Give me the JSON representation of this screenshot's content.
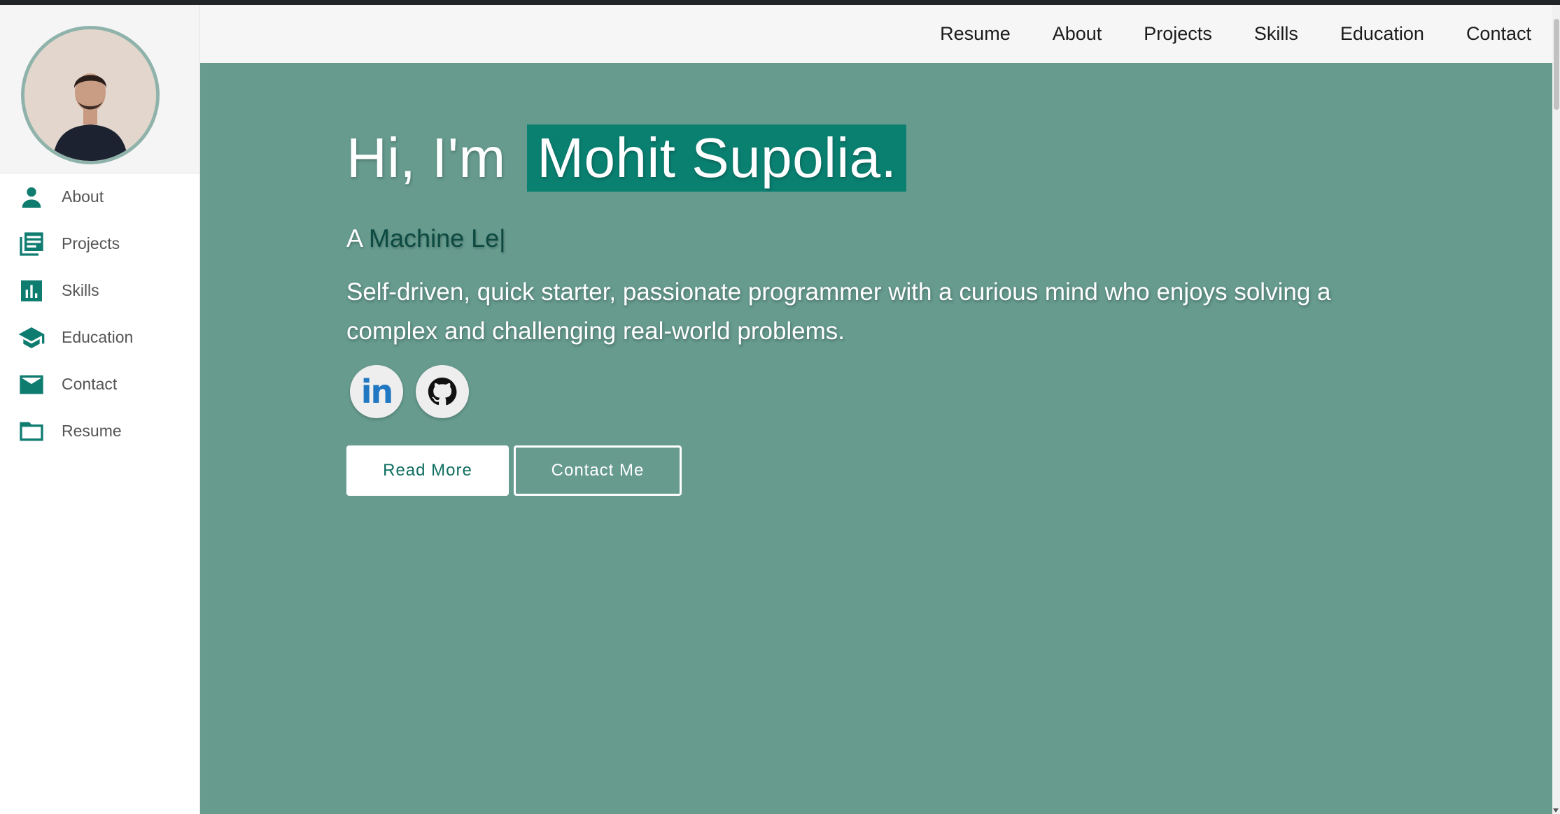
{
  "sidebar": {
    "items": [
      {
        "label": "About",
        "icon": "person-icon"
      },
      {
        "label": "Projects",
        "icon": "list-icon"
      },
      {
        "label": "Skills",
        "icon": "bar-chart-icon"
      },
      {
        "label": "Education",
        "icon": "graduation-cap-icon"
      },
      {
        "label": "Contact",
        "icon": "mail-icon"
      },
      {
        "label": "Resume",
        "icon": "folder-icon"
      }
    ]
  },
  "topnav": {
    "links": [
      "Resume",
      "About",
      "Projects",
      "Skills",
      "Education",
      "Contact"
    ]
  },
  "hero": {
    "greeting": "Hi, I'm",
    "name": "Mohit Supolia.",
    "typed_prefix": "A",
    "typed_text": "Machine Le",
    "typed_cursor": "|",
    "tagline": "Self-driven, quick starter, passionate programmer with a curious mind who enjoys solving a complex and challenging real-world problems.",
    "socials": [
      {
        "icon": "linkedin-icon",
        "glyph": "in"
      },
      {
        "icon": "github-icon"
      }
    ],
    "read_more_label": "Read More",
    "contact_me_label": "Contact Me"
  },
  "colors": {
    "accent": "#0a8071",
    "hero_bg": "#669b8e",
    "icon": "#0f7c70",
    "typed_word": "#0c4a41"
  }
}
